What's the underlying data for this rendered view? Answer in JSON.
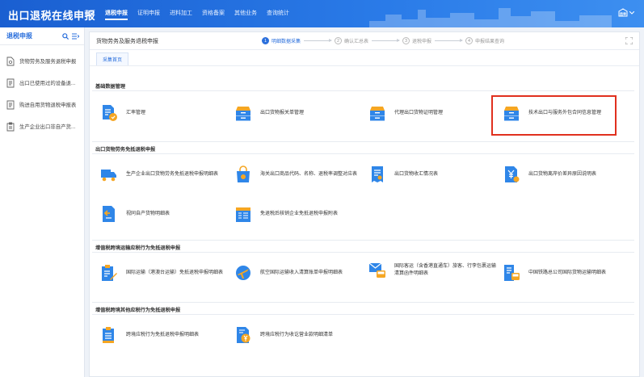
{
  "app": {
    "title": "出口退税在线申报"
  },
  "topnav": [
    {
      "label": "首页",
      "active": false
    },
    {
      "label": "退税申报",
      "active": true
    },
    {
      "label": "证明申报",
      "active": false
    },
    {
      "label": "进料加工",
      "active": false
    },
    {
      "label": "资格备案",
      "active": false
    },
    {
      "label": "其他业务",
      "active": false
    },
    {
      "label": "查询统计",
      "active": false
    }
  ],
  "sidebar": {
    "title": "退税申报",
    "items": [
      {
        "label": "货物劳务及服务退税申报",
        "icon": "document-icon"
      },
      {
        "label": "出口已使用过的设备退...",
        "icon": "document-list-icon"
      },
      {
        "label": "购进自用货物退税申报表",
        "icon": "document-list-icon"
      },
      {
        "label": "生产企业出口非自产货...",
        "icon": "clipboard-icon"
      }
    ]
  },
  "main": {
    "title": "货物劳务及服务退税申报",
    "steps": [
      {
        "num": "1",
        "label": "明细数据采集",
        "active": true
      },
      {
        "num": "2",
        "label": "确认汇总表",
        "active": false
      },
      {
        "num": "3",
        "label": "退税申报",
        "active": false
      },
      {
        "num": "4",
        "label": "申报结果查询",
        "active": false
      }
    ],
    "tab": "采集首页",
    "sections": [
      {
        "title": "基础数据管理",
        "items": [
          {
            "label": "汇率管理",
            "icon": "exchange-rate-doc-icon"
          },
          {
            "label": "出口货物报关单管理",
            "icon": "file-cabinet-icon"
          },
          {
            "label": "代理出口货物证明管理",
            "icon": "file-cabinet-icon"
          },
          {
            "label": "技术出口与服务外包合同信息管理",
            "icon": "file-cabinet-icon"
          }
        ]
      },
      {
        "title": "出口货物劳务免抵退税申报",
        "items": [
          {
            "label": "生产企业出口货物劳务免抵退税申报明细表",
            "icon": "truck-icon"
          },
          {
            "label": "海关出口商品代码、名称、退税率调整对应表",
            "icon": "shopping-bag-icon"
          },
          {
            "label": "出口货物收汇情况表",
            "icon": "receipt-icon"
          },
          {
            "label": "出口货物离岸价差异原因说明表",
            "icon": "yuan-doc-icon"
          },
          {
            "label": "视同自产货物明细表",
            "icon": "return-doc-icon"
          },
          {
            "label": "免退税后核销企业免抵退税申报附表",
            "icon": "calendar-doc-icon"
          }
        ]
      },
      {
        "title": "增值税跨境运输应税行为免抵退税申报",
        "items": [
          {
            "label": "国际运输（港澳台运输）免抵退税申报明细表",
            "icon": "clipboard-pen-icon"
          },
          {
            "label": "航空国际运输收入清算账单申报明细表",
            "icon": "airplane-icon"
          },
          {
            "label": "国际客运（含香港直通车）旅客、行李包裹运输清算函件明细表",
            "lines": [
              "国际客运（含香港直通车）旅客、行李包裹运输",
              "清算函件明细表"
            ],
            "icon": "mail-bus-icon"
          },
          {
            "label": "中国铁路总公司国际货物运输明细表",
            "icon": "train-doc-icon"
          }
        ]
      },
      {
        "title": "增值税跨境其他应税行为免抵退税申报",
        "items": [
          {
            "label": "跨境应税行为免抵退税申报明细表",
            "icon": "clipboard-list-icon"
          },
          {
            "label": "跨境应税行为收讫营业款明细清单",
            "icon": "yuan-doc-icon"
          }
        ]
      }
    ]
  },
  "colors": {
    "brand": "#2a6fdc",
    "icon_blue": "#2f86e8",
    "icon_orange": "#f5a623",
    "highlight": "#e0301e"
  }
}
